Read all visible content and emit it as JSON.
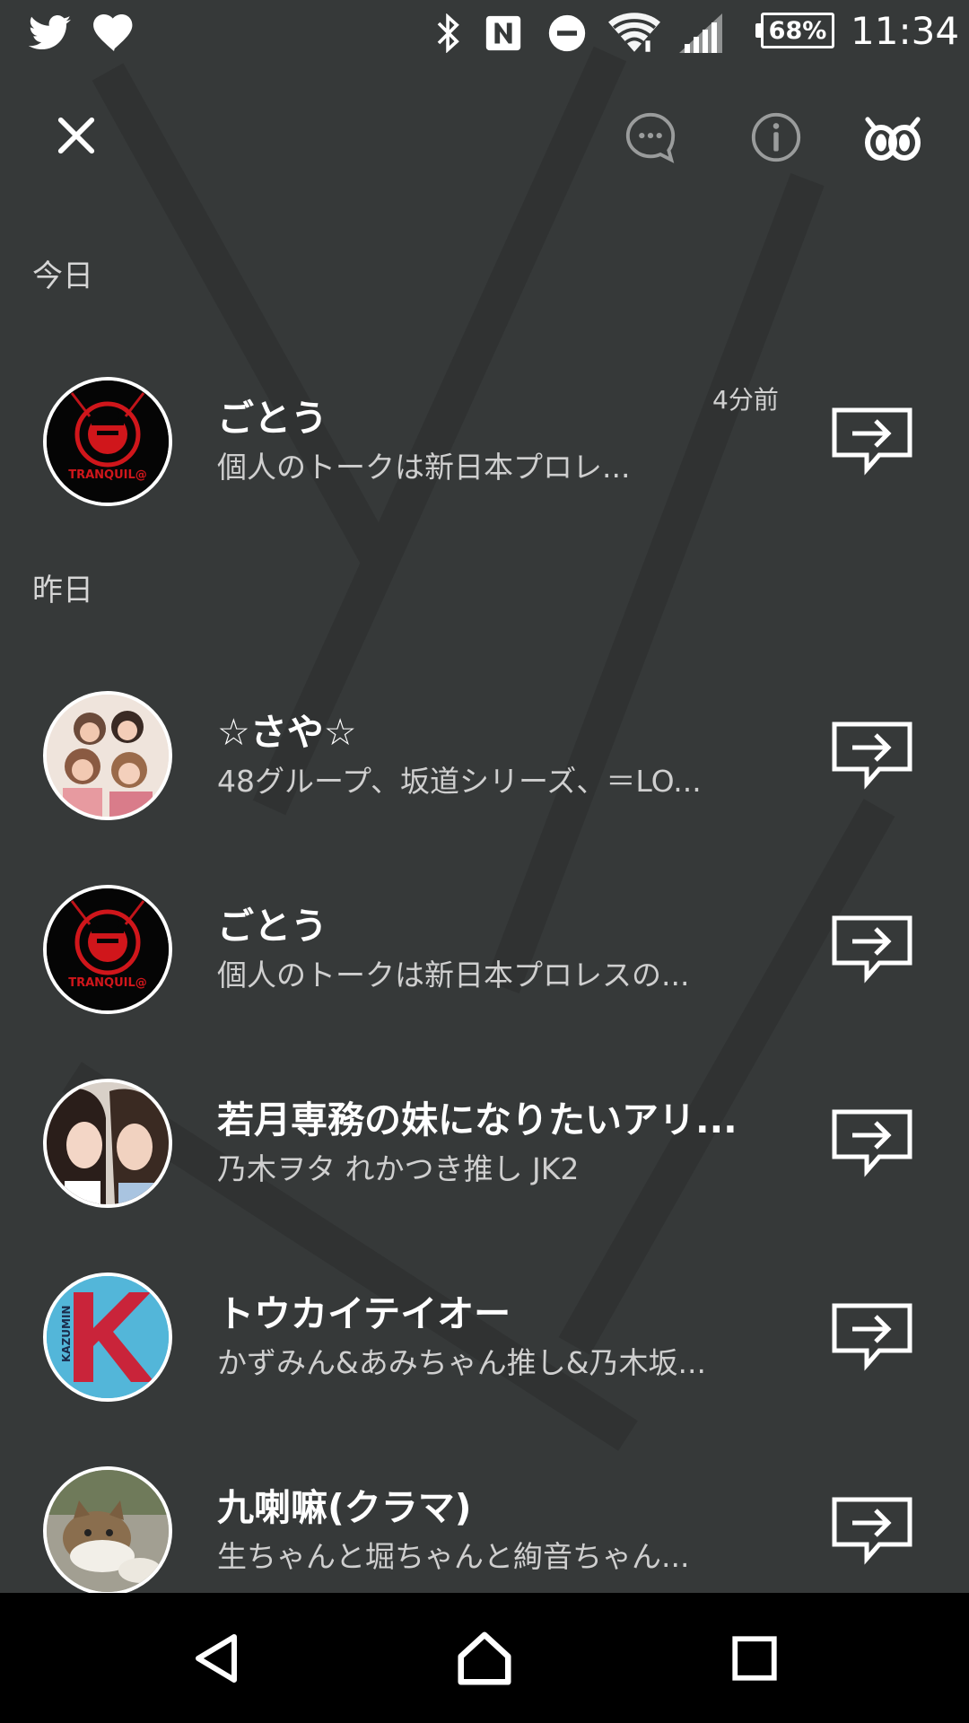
{
  "status_bar": {
    "battery_text": "68%",
    "time": "11:34",
    "icons": [
      "twitter-icon",
      "heart-icon",
      "bluetooth-icon",
      "nfc-icon",
      "do-not-disturb-icon",
      "wifi-icon",
      "cell-signal-icon",
      "battery-icon"
    ]
  },
  "header": {
    "icons": [
      "close-icon",
      "chat-bubble-icon",
      "info-icon",
      "keep-icon"
    ]
  },
  "sections": [
    {
      "label": "今日"
    },
    {
      "label": "昨日"
    }
  ],
  "chats": [
    {
      "name": "ごとう",
      "preview": "個人のトークは新日本プロレ...",
      "time": "4分前",
      "avatar": "tranquilo-logo"
    },
    {
      "name": "☆さや☆",
      "preview": "48グループ、坂道シリーズ、＝LO...",
      "time": "",
      "avatar": "group-photo"
    },
    {
      "name": "ごとう",
      "preview": "個人のトークは新日本プロレスの...",
      "time": "",
      "avatar": "tranquilo-logo"
    },
    {
      "name": "若月専務の妹になりたいアリ...",
      "preview": "乃木ヲタ  れかつき推し  JK2",
      "time": "",
      "avatar": "duo-photo"
    },
    {
      "name": "トウカイテイオー",
      "preview": "かずみん&あみちゃん推し&乃木坂...",
      "time": "",
      "avatar": "k-logo"
    },
    {
      "name": "九喇嘛(クラマ)",
      "preview": "生ちゃんと堀ちゃんと絢音ちゃん...",
      "time": "",
      "avatar": "cat-photo"
    }
  ],
  "nav_bar": {
    "icons": [
      "back-icon",
      "home-icon",
      "recents-icon"
    ]
  },
  "colors": {
    "background": "#363939",
    "nav_background": "#000000",
    "accent_red": "#d0161b",
    "text_primary": "#ffffff",
    "text_secondary": "#cfcfcf"
  }
}
